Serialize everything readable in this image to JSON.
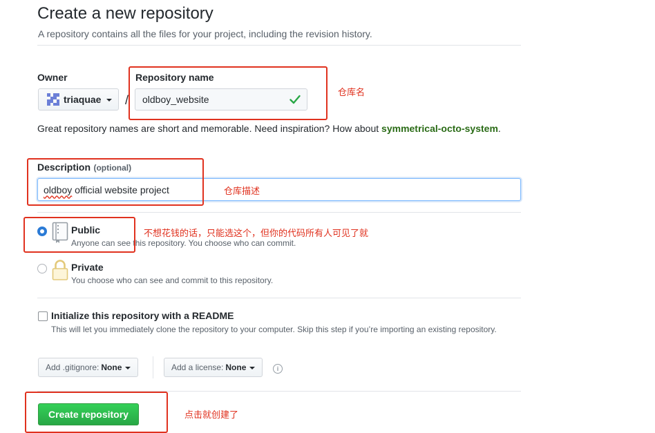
{
  "header": {
    "title": "Create a new repository",
    "subtitle": "A repository contains all the files for your project, including the revision history."
  },
  "owner": {
    "label": "Owner",
    "value": "triaquae"
  },
  "repository": {
    "label": "Repository name",
    "value": "oldboy_website"
  },
  "hint": {
    "text": "Great repository names are short and memorable. Need inspiration? How about",
    "suggestion": "symmetrical-octo-system",
    "suffix": "."
  },
  "description": {
    "label": "Description",
    "optional": "(optional)",
    "value_word": "oldboy",
    "value_rest": " official website project"
  },
  "visibility": {
    "public_title": "Public",
    "public_desc": "Anyone can see this repository. You choose who can commit.",
    "private_title": "Private",
    "private_desc": "You choose who can see and commit to this repository.",
    "selected": "public"
  },
  "readme": {
    "title": "Initialize this repository with a README",
    "desc": "This will let you immediately clone the repository to your computer. Skip this step if you’re importing an existing repository.",
    "checked": false
  },
  "gitignore": {
    "prefix": "Add .gitignore:",
    "value": "None"
  },
  "license": {
    "prefix": "Add a license:",
    "value": "None"
  },
  "create_button": "Create repository",
  "annotations": {
    "repo_name": "仓库名",
    "description": "仓库描述",
    "public": "不想花钱的话，只能选这个，但你的代码所有人可见了就",
    "create": "点击就创建了"
  },
  "colors": {
    "annotation": "#e0311e",
    "create_button": "#28a745",
    "suggestion": "#2a6b16"
  }
}
